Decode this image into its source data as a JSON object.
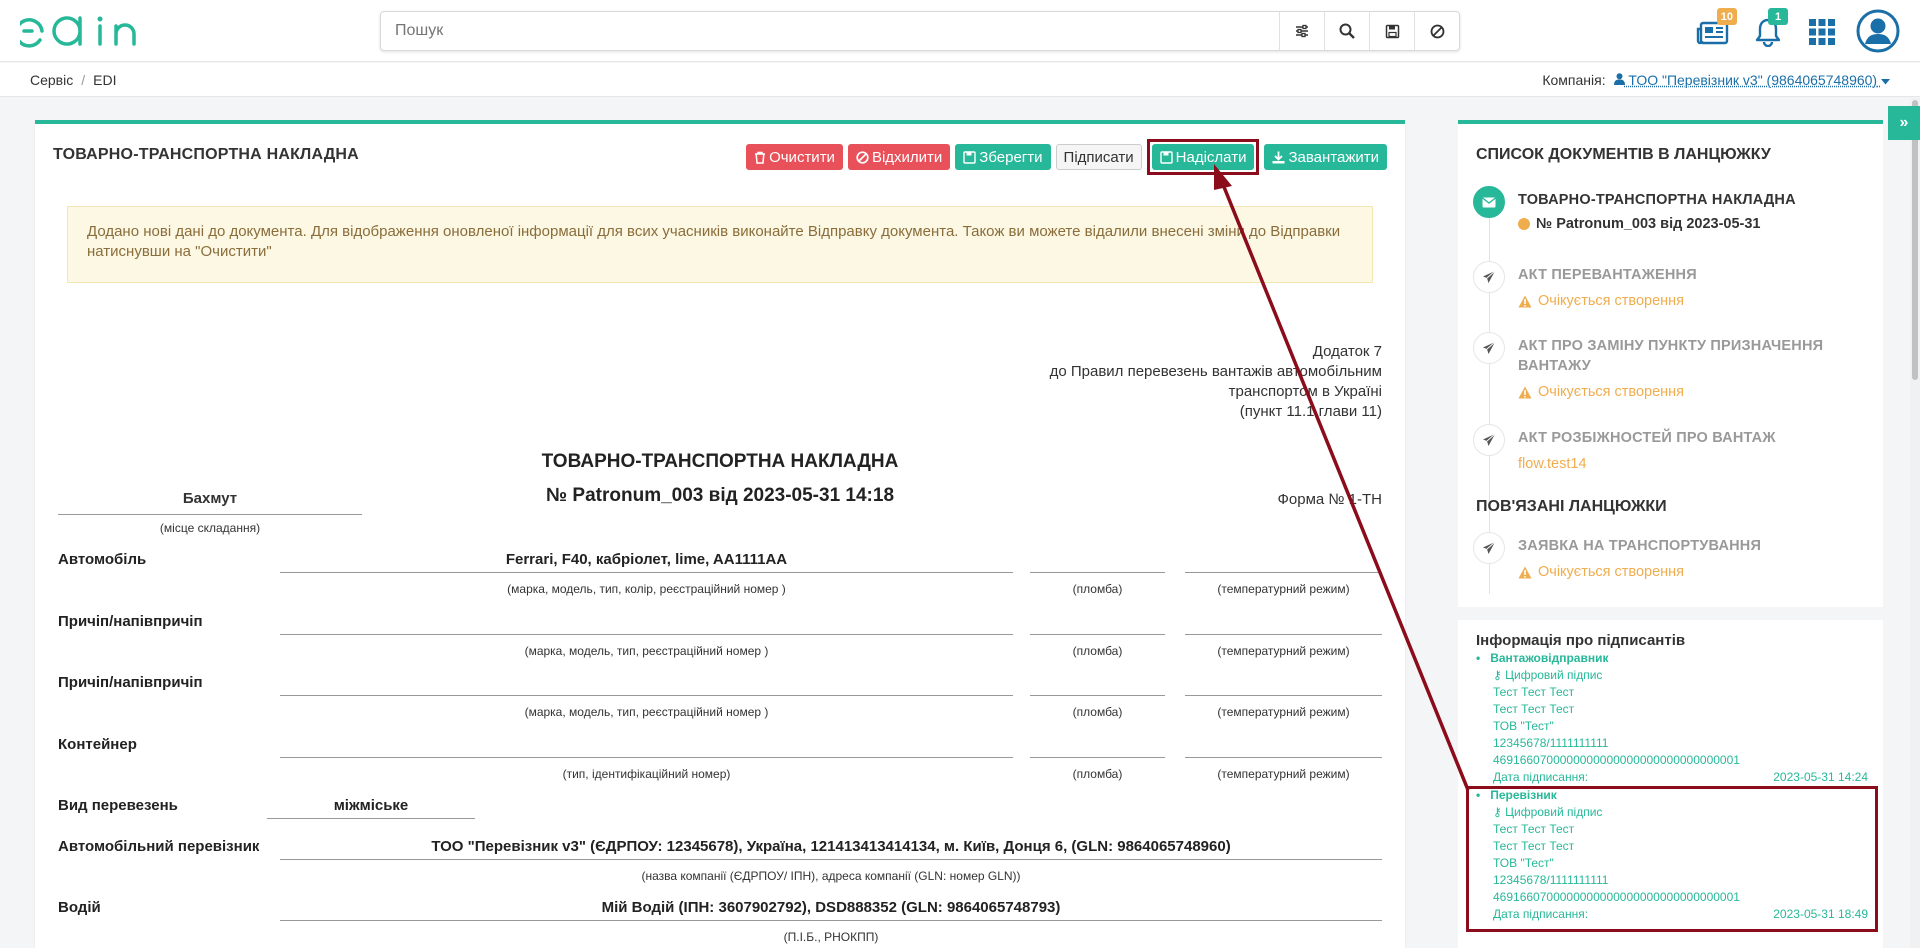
{
  "header": {
    "search_placeholder": "Пошук",
    "news_badge": "10",
    "notif_badge": "1"
  },
  "breadcrumbs": {
    "service": "Сервіс",
    "sep": "/",
    "edi": "EDI"
  },
  "company": {
    "label": "Компанія:",
    "name": "ТОО \"Перевізник v3\" (9864065748960)"
  },
  "doc": {
    "heading": "ТОВАРНО-ТРАНСПОРТНА НАКЛАДНА",
    "buttons": {
      "clear": "Очистити",
      "reject": "Відхилити",
      "save": "Зберегти",
      "sign": "Підписати",
      "send": "Надіслати",
      "download": "Завантажити"
    },
    "alert": "Додано нові дані до документа. Для відображення оновленої інформації для всих учасників виконайте Відправку документа. Також ви можете відалили внесені зміни до Відправки натиснувши на \"Очистити\"",
    "appendix": [
      "Додаток 7",
      "до Правил перевезень вантажів автомобільним",
      "транспортом в Україні",
      "(пункт 11.1 глави 11)"
    ],
    "title": "ТОВАРНО-ТРАНСПОРТНА НАКЛАДНА",
    "number": "№ Patronum_003 від 2023-05-31 14:18",
    "place": "Бахмут",
    "place_caption": "(місце складання)",
    "form_no": "Форма № 1-ТН",
    "rows": {
      "car_label": "Автомобіль",
      "car_value": "Ferrari, F40, кабріолет, lime, AA1111AA",
      "car_caption": "(марка, модель, тип, колір, реєстраційний номер )",
      "trailer1_label": "Причіп/напівпричіп",
      "trailer2_label": "Причіп/напівпричіп",
      "trailer_caption": "(марка, модель, тип, реєстраційний номер )",
      "container_label": "Контейнер",
      "container_caption": "(тип, ідентифікаційний номер)",
      "seal_caption": "(пломба)",
      "temp_caption": "(температурний режим)",
      "transport_type_label": "Вид перевезень",
      "transport_type_value": "міжміське",
      "carrier_label": "Автомобільний перевізник",
      "carrier_value": "ТОО \"Перевізник v3\" (ЄДРПОУ: 12345678), Україна, 121413413414134, м. Київ, Донця 6, (GLN: 9864065748960)",
      "carrier_caption": "(назва компанії (ЄДРПОУ/ ІПН), адреса компанії (GLN: номер GLN))",
      "driver_label": "Водій",
      "driver_value": "Мій Водій (ІПН: 3607902792), DSD888352 (GLN: 9864065748793)",
      "driver_caption": "(П.І.Б., РНОКПП)"
    }
  },
  "chain": {
    "title": "СПИСОК ДОКУМЕНТІВ В ЛАНЦЮЖКУ",
    "items": [
      {
        "title": "ТОВАРНО-ТРАНСПОРТНА НАКЛАДНА",
        "sub": "№ Patronum_003 від 2023-05-31"
      },
      {
        "title": "АКТ ПЕРЕВАНТАЖЕННЯ",
        "sub": "Очікується створення"
      },
      {
        "title": "АКТ ПРО ЗАМІНУ ПУНКТУ ПРИЗНАЧЕННЯ ВАНТАЖУ",
        "sub": "Очікується створення"
      },
      {
        "title": "АКТ РОЗБІЖНОСТЕЙ ПРО ВАНТАЖ",
        "sub": "flow.test14"
      }
    ],
    "related_title": "ПОВ'ЯЗАНІ ЛАНЦЮЖКИ",
    "related": [
      {
        "title": "ЗАЯВКА НА ТРАНСПОРТУВАННЯ",
        "sub": "Очікується створення"
      }
    ]
  },
  "signers": {
    "title": "Інформація про підписантів",
    "list": [
      {
        "role": "Вантажовідправник",
        "sig": "Цифровий підпис",
        "name1": "Тест Тест Тест",
        "name2": "Тест Тест Тест",
        "org": "ТОВ \"Тест\"",
        "code": "12345678/1111111111",
        "serial": "4691660700000000000000000000000000001",
        "date_label": "Дата підписання:",
        "date": "2023-05-31 14:24"
      },
      {
        "role": "Перевізник",
        "sig": "Цифровий підпис",
        "name1": "Тест Тест Тест",
        "name2": "Тест Тест Тест",
        "org": "ТОВ \"Тест\"",
        "code": "12345678/1111111111",
        "serial": "4691660700000000000000000000000000001",
        "date_label": "Дата підписання:",
        "date": "2023-05-31 18:49"
      }
    ]
  },
  "colors": {
    "accent": "#27b899",
    "danger": "#e8515a",
    "brand": "#1a6fa8",
    "highlight": "#8b0c1a",
    "warning": "#f0ad4e"
  }
}
